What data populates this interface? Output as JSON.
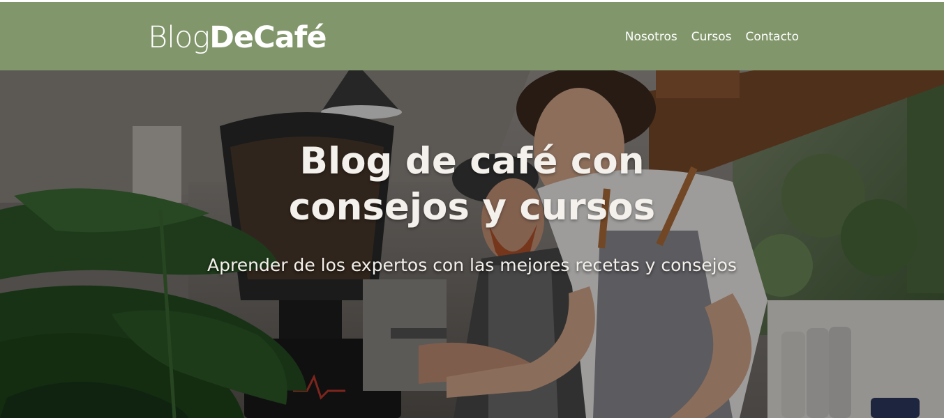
{
  "header": {
    "logo_light": "Blog",
    "logo_bold": "DeCafé",
    "background_color": "#81976b",
    "nav": [
      {
        "label": "Nosotros"
      },
      {
        "label": "Cursos"
      },
      {
        "label": "Contacto"
      }
    ]
  },
  "hero": {
    "title_line1": "Blog de café con",
    "title_line2": "consejos y cursos",
    "subtitle": "Aprender de los expertos con las mejores recetas y consejos",
    "image_subject": "baristas-preparing-coffee-photo"
  }
}
